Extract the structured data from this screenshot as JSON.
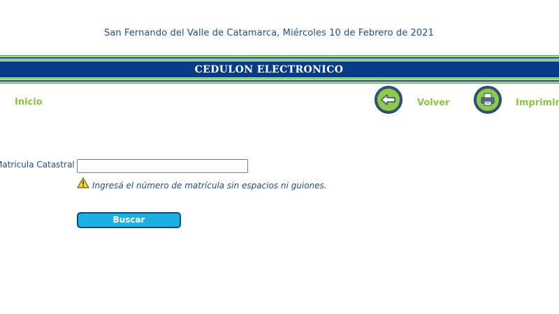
{
  "header": {
    "date_line": "San Fernando del Valle de Catamarca, Miércoles 10 de Febrero de 2021",
    "banner_title": "CEDULON ELECTRONICO"
  },
  "nav": {
    "inicio_label": "Inicio",
    "volver_label": "Volver",
    "imprimir_label": "Imprimir"
  },
  "form": {
    "field_label": "Matricula Catastral",
    "field_value": "",
    "hint": "Ingresá el número de matrícula sin espacios ni guiones.",
    "search_label": "Buscar"
  },
  "colors": {
    "banner_blue": "#0a3c86",
    "stripe_green": "#6cc04a",
    "nav_green": "#8cc342",
    "text_blue": "#1e4f86",
    "button_cyan": "#1ab0e0"
  },
  "icons": {
    "volver": "back-arrow-icon",
    "imprimir": "printer-icon",
    "hint": "warning-icon"
  }
}
